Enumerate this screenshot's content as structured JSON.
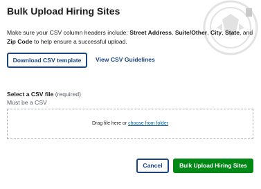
{
  "modal": {
    "title": "Bulk Upload Hiring Sites",
    "intro": {
      "prefix": "Make sure your CSV column headers include: ",
      "fields": [
        "Street Address",
        "Suite/Other",
        "City",
        "State"
      ],
      "separator": ", ",
      "and_text": ", and ",
      "last_field": "Zip Code",
      "suffix": " to help ensure a successful upload."
    },
    "download_button_label": "Download CSV template",
    "guidelines_link_label": "View CSV Guidelines",
    "file_field": {
      "label": "Select a CSV file",
      "required_text": "(required)",
      "hint": "Must be a CSV"
    },
    "dropzone": {
      "text": "Drag file here or ",
      "link_text": "choose from folder"
    },
    "cancel_button_label": "Cancel",
    "submit_button_label": "Bulk Upload Hiring Sites"
  },
  "colors": {
    "primary_dark_blue": "#1a4480",
    "link_blue": "#005ea2",
    "success_green": "#008817",
    "hint_gray": "#565c65"
  },
  "icons": {
    "close": "close-icon",
    "watermark": "seal-watermark"
  }
}
